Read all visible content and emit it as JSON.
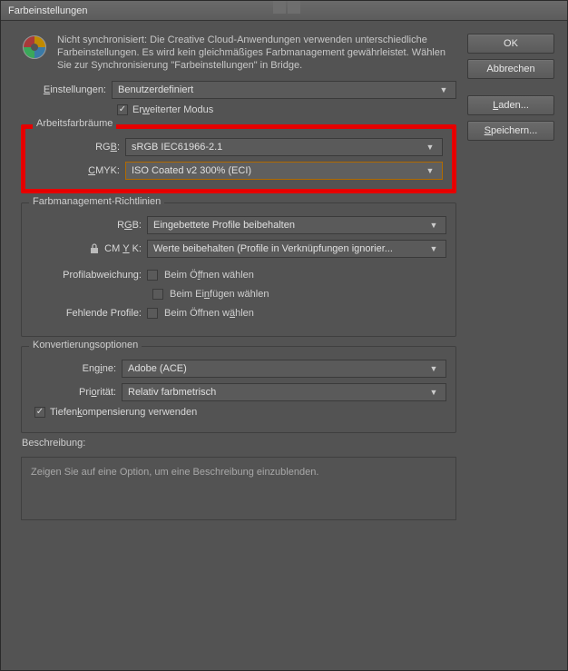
{
  "window": {
    "title": "Farbeinstellungen"
  },
  "buttons": {
    "ok": "OK",
    "cancel": "Abbrechen",
    "load": "Laden...",
    "save": "Speichern..."
  },
  "sync": "Nicht synchronisiert: Die Creative Cloud-Anwendungen verwenden unterschiedliche Farbeinstellungen. Es wird kein gleichmäßiges Farbmanagement gewährleistet. Wählen Sie zur Synchronisierung \"Farbeinstellungen\" in Bridge.",
  "settings": {
    "label": "Einstellungen:",
    "value": "Benutzerdefiniert",
    "adv": "Erweiterter Modus"
  },
  "workspaces": {
    "title": "Arbeitsfarbräume",
    "rgb_label": "RGB:",
    "rgb_value": "sRGB IEC61966-2.1",
    "cmyk_label": "CMYK:",
    "cmyk_value": "ISO Coated v2 300% (ECI)"
  },
  "policies": {
    "title": "Farbmanagement-Richtlinien",
    "rgb_label": "RGB:",
    "rgb_value": "Eingebettete Profile beibehalten",
    "cmyk_label": "CMYK:",
    "cmyk_value": "Werte beibehalten (Profile in Verknüpfungen ignorier...",
    "mismatch_label": "Profilabweichung:",
    "mismatch_open": "Beim Öffnen wählen",
    "mismatch_paste": "Beim Einfügen wählen",
    "missing_label": "Fehlende Profile:",
    "missing_open": "Beim Öffnen wählen"
  },
  "conversion": {
    "title": "Konvertierungsoptionen",
    "engine_label": "Engine:",
    "engine_value": "Adobe (ACE)",
    "intent_label": "Priorität:",
    "intent_value": "Relativ farbmetrisch",
    "blackpoint": "Tiefenkompensierung verwenden"
  },
  "description": {
    "title": "Beschreibung:",
    "text": "Zeigen Sie auf eine Option, um eine Beschreibung einzublenden."
  }
}
